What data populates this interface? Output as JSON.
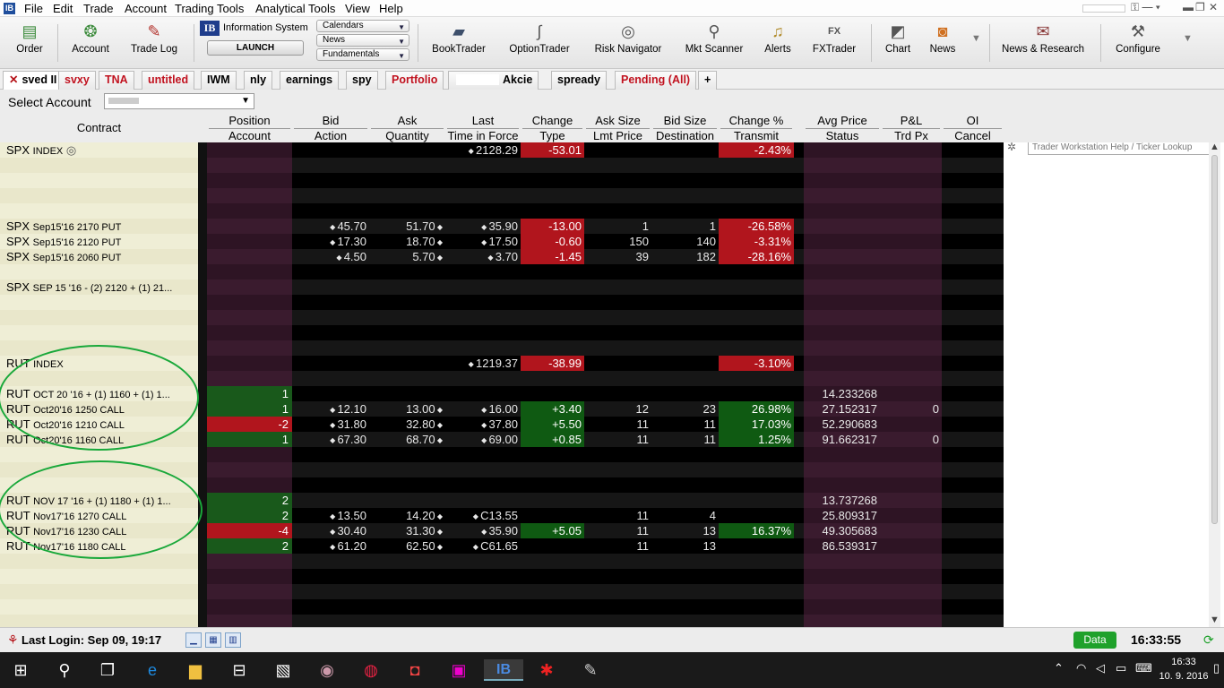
{
  "menu": [
    "File",
    "Edit",
    "Trade",
    "Account",
    "Trading Tools",
    "Analytical Tools",
    "View",
    "Help"
  ],
  "toolbar": {
    "left_buttons": [
      "Order",
      "Account",
      "Trade Log"
    ],
    "info_system": "Information System",
    "launch": "LAUNCH",
    "dropdowns": [
      "Calendars",
      "News",
      "Fundamentals"
    ],
    "right_buttons": [
      "BookTrader",
      "OptionTrader",
      "Risk Navigator",
      "Mkt Scanner",
      "Alerts",
      "FXTrader",
      "Chart",
      "News",
      "News & Research",
      "Configure"
    ]
  },
  "tabs": [
    {
      "label": "sved II",
      "color": "black",
      "close": true
    },
    {
      "label": "svxy",
      "color": "red"
    },
    {
      "label": "TNA",
      "color": "red"
    },
    {
      "label": "untitled",
      "color": "red"
    },
    {
      "label": "IWM",
      "color": "black"
    },
    {
      "label": "nly",
      "color": "black"
    },
    {
      "label": "earnings",
      "color": "black"
    },
    {
      "label": "spy",
      "color": "black"
    },
    {
      "label": "Portfolio",
      "color": "red"
    },
    {
      "label": "Akcie",
      "color": "black"
    },
    {
      "label": "spready",
      "color": "black"
    },
    {
      "label": "Pending (All)",
      "color": "red"
    },
    {
      "label": "+",
      "color": "black"
    }
  ],
  "help_search_placeholder": "Trader Workstation Help / Ticker Lookup",
  "select_account_label": "Select Account",
  "columns": {
    "contract": "Contract",
    "top": [
      "Position",
      "Bid",
      "Ask",
      "Last",
      "Change",
      "Ask Size",
      "Bid Size",
      "Change %",
      "Avg Price",
      "P&L",
      "OI"
    ],
    "bottom": [
      "Account",
      "Action",
      "Quantity",
      "Time in Force",
      "Type",
      "Lmt Price",
      "Destination",
      "Transmit",
      "Status",
      "Trd Px",
      "Cancel"
    ]
  },
  "rows": [
    {
      "sym": "SPX",
      "desc": "INDEX",
      "pos": "",
      "bid": "",
      "ask": "",
      "last": "2128.29",
      "chg": "-53.01",
      "asksz": "",
      "bidsz": "",
      "chgpct": "-2.43%",
      "avg": "",
      "pnl": "",
      "dir": "neg"
    },
    {},
    {},
    {},
    {},
    {
      "sym": "SPX",
      "desc": "Sep15'16 2170 PUT",
      "pos": "",
      "bid": "45.70",
      "ask": "51.70",
      "last": "35.90",
      "chg": "-13.00",
      "asksz": "1",
      "bidsz": "1",
      "chgpct": "-26.58%",
      "avg": "",
      "pnl": "",
      "dir": "neg"
    },
    {
      "sym": "SPX",
      "desc": "Sep15'16 2120 PUT",
      "pos": "",
      "bid": "17.30",
      "ask": "18.70",
      "last": "17.50",
      "chg": "-0.60",
      "asksz": "150",
      "bidsz": "140",
      "chgpct": "-3.31%",
      "avg": "",
      "pnl": "",
      "dir": "neg"
    },
    {
      "sym": "SPX",
      "desc": "Sep15'16 2060 PUT",
      "pos": "",
      "bid": "4.50",
      "ask": "5.70",
      "last": "3.70",
      "chg": "-1.45",
      "asksz": "39",
      "bidsz": "182",
      "chgpct": "-28.16%",
      "avg": "",
      "pnl": "",
      "dir": "neg"
    },
    {},
    {
      "sym": "SPX",
      "desc": "SEP 15 '16 - (2) 2120 + (1) 21...",
      "pos": "",
      "bid": "",
      "ask": "",
      "last": "",
      "chg": "",
      "asksz": "",
      "bidsz": "",
      "chgpct": "",
      "avg": "",
      "pnl": "",
      "dir": ""
    },
    {},
    {},
    {},
    {},
    {
      "sym": "RUT",
      "desc": "INDEX",
      "pos": "",
      "bid": "",
      "ask": "",
      "last": "1219.37",
      "chg": "-38.99",
      "asksz": "",
      "bidsz": "",
      "chgpct": "-3.10%",
      "avg": "",
      "pnl": "",
      "dir": "neg"
    },
    {},
    {
      "sym": "RUT",
      "desc": "OCT 20 '16 + (1) 1160 + (1) 1...",
      "pos": "1",
      "bid": "",
      "ask": "",
      "last": "",
      "chg": "",
      "asksz": "",
      "bidsz": "",
      "chgpct": "",
      "avg": "14.233268",
      "pnl": "",
      "dir": "",
      "posdir": "pos"
    },
    {
      "sym": "RUT",
      "desc": "Oct20'16 1250 CALL",
      "pos": "1",
      "bid": "12.10",
      "ask": "13.00",
      "last": "16.00",
      "chg": "+3.40",
      "asksz": "12",
      "bidsz": "23",
      "chgpct": "26.98%",
      "avg": "27.152317",
      "pnl": "0",
      "dir": "pos",
      "posdir": "pos"
    },
    {
      "sym": "RUT",
      "desc": "Oct20'16 1210 CALL",
      "pos": "-2",
      "bid": "31.80",
      "ask": "32.80",
      "last": "37.80",
      "chg": "+5.50",
      "asksz": "11",
      "bidsz": "11",
      "chgpct": "17.03%",
      "avg": "52.290683",
      "pnl": "",
      "dir": "pos",
      "posdir": "neg"
    },
    {
      "sym": "RUT",
      "desc": "Oct20'16 1160 CALL",
      "pos": "1",
      "bid": "67.30",
      "ask": "68.70",
      "last": "69.00",
      "chg": "+0.85",
      "asksz": "11",
      "bidsz": "11",
      "chgpct": "1.25%",
      "avg": "91.662317",
      "pnl": "0",
      "dir": "pos",
      "posdir": "pos"
    },
    {},
    {},
    {},
    {
      "sym": "RUT",
      "desc": "NOV 17 '16 + (1) 1180 + (1) 1...",
      "pos": "2",
      "bid": "",
      "ask": "",
      "last": "",
      "chg": "",
      "asksz": "",
      "bidsz": "",
      "chgpct": "",
      "avg": "13.737268",
      "pnl": "",
      "dir": "",
      "posdir": "pos"
    },
    {
      "sym": "RUT",
      "desc": "Nov17'16 1270 CALL",
      "pos": "2",
      "bid": "13.50",
      "ask": "14.20",
      "last": "C13.55",
      "chg": "",
      "asksz": "11",
      "bidsz": "4",
      "chgpct": "",
      "avg": "25.809317",
      "pnl": "",
      "dir": "",
      "posdir": "pos"
    },
    {
      "sym": "RUT",
      "desc": "Nov17'16 1230 CALL",
      "pos": "-4",
      "bid": "30.40",
      "ask": "31.30",
      "last": "35.90",
      "chg": "+5.05",
      "asksz": "11",
      "bidsz": "13",
      "chgpct": "16.37%",
      "avg": "49.305683",
      "pnl": "",
      "dir": "pos",
      "posdir": "neg"
    },
    {
      "sym": "RUT",
      "desc": "Nov17'16 1180 CALL",
      "pos": "2",
      "bid": "61.20",
      "ask": "62.50",
      "last": "C61.65",
      "chg": "",
      "asksz": "11",
      "bidsz": "13",
      "chgpct": "",
      "avg": "86.539317",
      "pnl": "",
      "dir": "",
      "posdir": "pos"
    },
    {},
    {},
    {},
    {},
    {},
    {}
  ],
  "status": {
    "last_login": "Last Login: Sep 09, 19:17",
    "data": "Data",
    "clock": "16:33:55"
  },
  "taskbar": {
    "time": "16:33",
    "date": "10. 9. 2016"
  },
  "colors": {
    "neg": "#b1151d",
    "pos": "#0f5a12",
    "cream": "#efeed6",
    "purple": "#36182a"
  }
}
